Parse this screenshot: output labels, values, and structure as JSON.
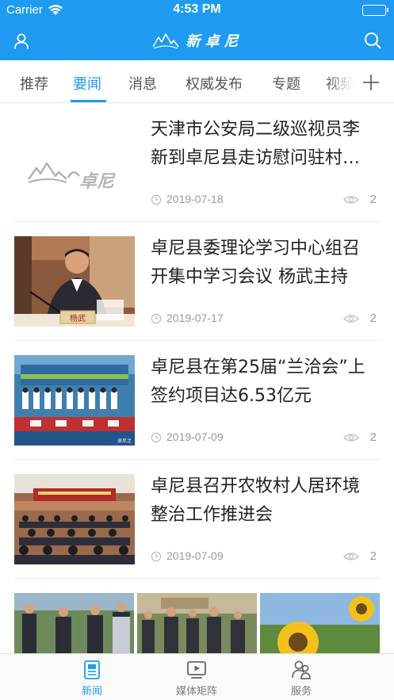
{
  "status_bar": {
    "carrier": "Carrier",
    "time": "4:53 PM"
  },
  "header": {
    "logo_text": "新卓尼",
    "user_icon": "user-icon",
    "search_icon": "search-icon",
    "bg_color": "#1e9bf0"
  },
  "tabs": {
    "items": [
      {
        "label": "推荐",
        "active": false
      },
      {
        "label": "要闻",
        "active": true
      },
      {
        "label": "消息",
        "active": false
      },
      {
        "label": "权威发布",
        "active": false
      },
      {
        "label": "专题",
        "active": false
      },
      {
        "label": "视频",
        "active": false
      }
    ],
    "add_icon": "plus-icon",
    "accent": "#1e9bf0"
  },
  "news": [
    {
      "title": "天津市公安局二级巡视员李新到卓尼县走访慰问驻村帮扶工作队",
      "date": "2019-07-18",
      "views": "2",
      "thumb": "logo-placeholder",
      "thumb_logo_text": "卓尼"
    },
    {
      "title": "卓尼县委理论学习中心组召开集中学习会议 杨武主持",
      "date": "2019-07-17",
      "views": "2",
      "thumb": "meeting-speaker-photo",
      "thumb_caption": "杨武"
    },
    {
      "title": "卓尼县在第25届“兰洽会”上签约项目达6.53亿元",
      "date": "2019-07-09",
      "views": "2",
      "thumb": "signing-ceremony-photo",
      "thumb_watermark": "卓尼之"
    },
    {
      "title": "卓尼县召开农牧村人居环境整治工作推进会",
      "date": "2019-07-09",
      "views": "2",
      "thumb": "conference-hall-photo"
    }
  ],
  "gallery": [
    "inspection-group-photo",
    "officials-walking-photo",
    "sunflower-photo"
  ],
  "bottom_tabs": [
    {
      "label": "新闻",
      "icon": "newspaper-icon",
      "active": true
    },
    {
      "label": "媒体矩阵",
      "icon": "video-play-icon",
      "active": false
    },
    {
      "label": "服务",
      "icon": "people-icon",
      "active": false
    }
  ]
}
